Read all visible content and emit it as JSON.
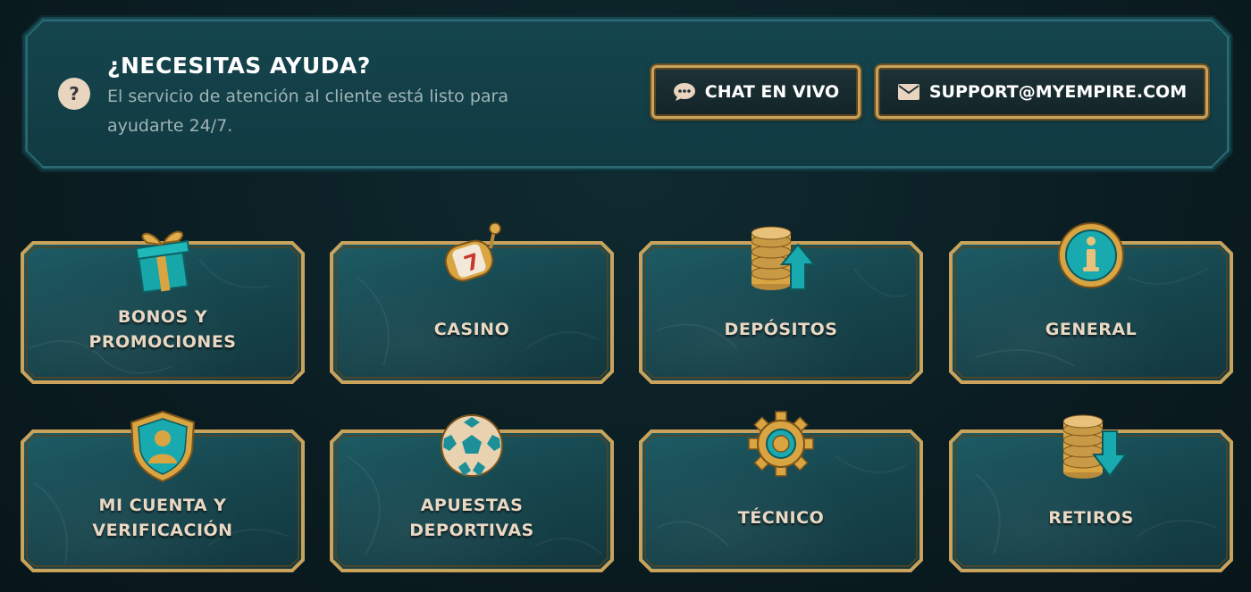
{
  "help": {
    "icon": "question-icon",
    "icon_glyph": "?",
    "title": "¿NECESITAS AYUDA?",
    "description": "El servicio de atención al cliente está listo para ayudarte 24/7.",
    "chat_label": "CHAT EN VIVO",
    "chat_icon": "chat-bubble-icon",
    "email_label": "SUPPORT@MYEMPIRE.COM",
    "email_icon": "envelope-icon"
  },
  "categories": [
    {
      "label": "BONOS Y\nPROMOCIONES",
      "icon": "gift-icon"
    },
    {
      "label": "CASINO",
      "icon": "slot-reel-icon"
    },
    {
      "label": "DEPÓSITOS",
      "icon": "coins-up-arrow-icon"
    },
    {
      "label": "GENERAL",
      "icon": "info-icon"
    },
    {
      "label": "MI CUENTA Y\nVERIFICACIÓN",
      "icon": "shield-user-icon"
    },
    {
      "label": "APUESTAS\nDEPORTIVAS",
      "icon": "soccer-ball-icon"
    },
    {
      "label": "TÉCNICO",
      "icon": "gear-icon"
    },
    {
      "label": "RETIROS",
      "icon": "coins-down-arrow-icon"
    }
  ],
  "colors": {
    "gold": "#c9a25b",
    "card_text": "#e9d8c3",
    "teal": "#1e5d66"
  }
}
